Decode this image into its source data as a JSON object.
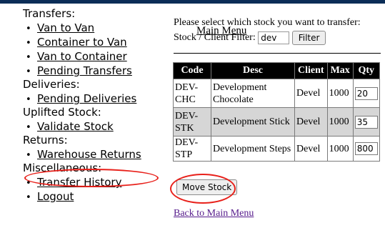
{
  "sidebar": {
    "main_menu": "Main Menu",
    "transfers": {
      "heading": "Transfers:",
      "items": [
        {
          "label": "Van to Van"
        },
        {
          "label": "Container to Van"
        },
        {
          "label": "Van to Container"
        },
        {
          "label": "Pending Transfers"
        }
      ]
    },
    "deliveries": {
      "heading": "Deliveries:",
      "items": [
        {
          "label": "Pending Deliveries"
        }
      ]
    },
    "uplifted": {
      "heading": "Uplifted Stock:",
      "items": [
        {
          "label": "Validate Stock"
        }
      ]
    },
    "returns": {
      "heading": "Returns:",
      "items": [
        {
          "label": "Warehouse Returns"
        }
      ]
    },
    "misc": {
      "heading": "Miscellaneous:",
      "items": [
        {
          "label": "Transfer History"
        },
        {
          "label": "Logout"
        }
      ]
    },
    "bullet": "•"
  },
  "main": {
    "prompt": "Please select which stock you want to transfer:",
    "filter_label": "Stock / Client Filter:",
    "filter_value": "dev",
    "filter_button": "Filter",
    "columns": [
      "Code",
      "Desc",
      "Client",
      "Max",
      "Qty"
    ],
    "rows": [
      {
        "code": "DEV-CHC",
        "desc": "Development Chocolate",
        "client": "Devel",
        "max": "1000",
        "qty": "20"
      },
      {
        "code": "DEV-STK",
        "desc": "Development Stick",
        "client": "Devel",
        "max": "1000",
        "qty": "35"
      },
      {
        "code": "DEV-STP",
        "desc": "Development Steps",
        "client": "Devel",
        "max": "1000",
        "qty": "800"
      }
    ],
    "move_button": "Move Stock",
    "back_link": "Back to Main Menu"
  },
  "colors": {
    "top_bar": "#0b2d57",
    "annotation_ring": "#e8201a",
    "table_header_bg": "#000000",
    "alt_row_bg": "#d6d6d6",
    "visited_link": "#551a8b"
  }
}
